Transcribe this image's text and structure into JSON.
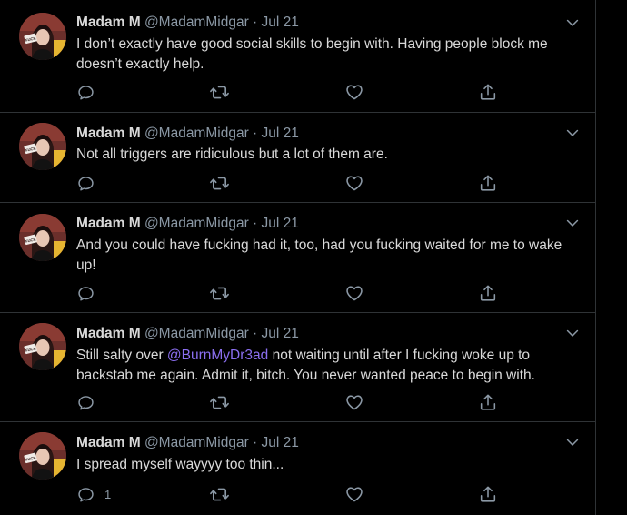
{
  "tweets": [
    {
      "name": "Madam M",
      "handle": "@MadamMidgar",
      "sep": "·",
      "date": "Jul 21",
      "text": "I don’t exactly have good social skills to begin with. Having people block me doesn’t exactly help.",
      "reply_count": ""
    },
    {
      "name": "Madam M",
      "handle": "@MadamMidgar",
      "sep": "·",
      "date": "Jul 21",
      "text": "Not all triggers are ridiculous but a lot of them are.",
      "reply_count": ""
    },
    {
      "name": "Madam M",
      "handle": "@MadamMidgar",
      "sep": "·",
      "date": "Jul 21",
      "text": "And you could have fucking had it, too, had you fucking waited for me to wake up!",
      "reply_count": ""
    },
    {
      "name": "Madam M",
      "handle": "@MadamMidgar",
      "sep": "·",
      "date": "Jul 21",
      "text_before": "Still salty over ",
      "mention": "@BurnMyDr3ad",
      "text_after": " not waiting until after I fucking woke up to backstab me again. Admit it, bitch. You never wanted peace to begin with.",
      "reply_count": ""
    },
    {
      "name": "Madam M",
      "handle": "@MadamMidgar",
      "sep": "·",
      "date": "Jul 21",
      "text": "I spread myself wayyyy too thin...",
      "reply_count": "1"
    }
  ],
  "avatar_text": "FUCK",
  "icons": {
    "caret": "chevron-down-icon",
    "reply": "reply-icon",
    "retweet": "retweet-icon",
    "like": "heart-icon",
    "share": "share-icon"
  },
  "colors": {
    "background": "#000000",
    "text": "#d9d9d9",
    "secondary": "#8b98a5",
    "mention": "#8b6ff0",
    "divider": "#2f3336"
  }
}
